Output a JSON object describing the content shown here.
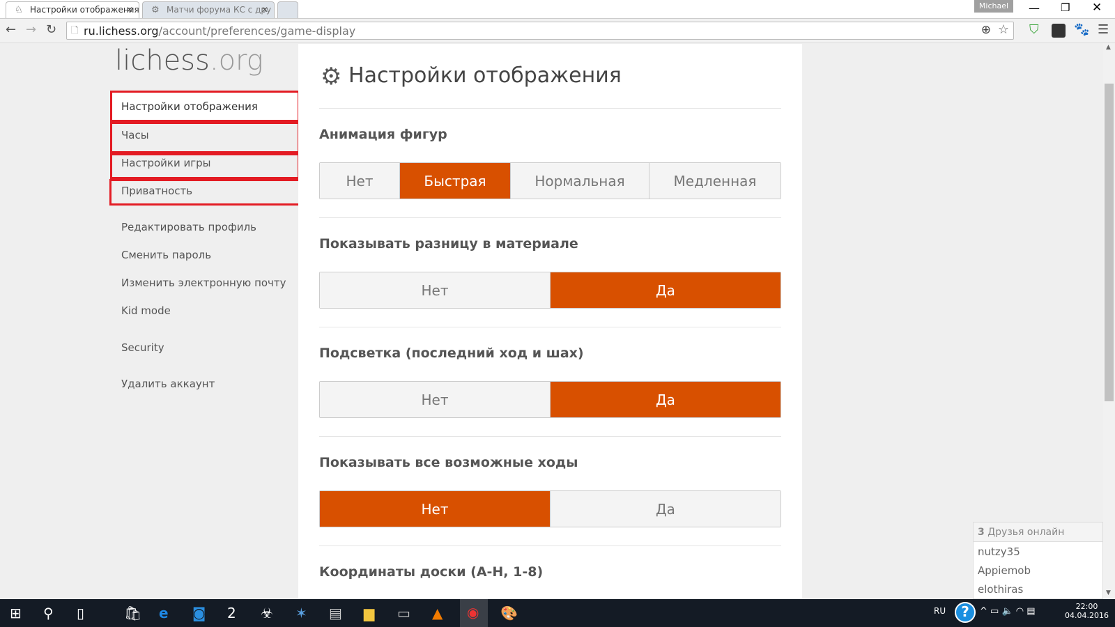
{
  "browser": {
    "tabs": [
      {
        "label": "Настройки отображения",
        "active": true
      },
      {
        "label": "Матчи форума КС с дру",
        "active": false
      }
    ],
    "user": "Michael",
    "url_host": "ru.lichess.org",
    "url_path": "/account/preferences/game-display"
  },
  "logo": {
    "main": "lichess",
    "tld": ".org"
  },
  "sidebar": {
    "items": [
      {
        "label": "Настройки отображения",
        "highlighted": true
      },
      {
        "label": "Часы",
        "highlighted": true
      },
      {
        "label": "Настройки игры",
        "highlighted": true
      },
      {
        "label": "Приватность",
        "highlighted": true
      },
      {
        "label": "Редактировать профиль"
      },
      {
        "label": "Сменить пароль"
      },
      {
        "label": "Изменить электронную почту"
      },
      {
        "label": "Kid mode"
      },
      {
        "label": "Security"
      },
      {
        "label": "Удалить аккаунт"
      }
    ]
  },
  "main": {
    "title": "Настройки отображения",
    "sections": [
      {
        "heading": "Анимация фигур",
        "options": [
          "Нет",
          "Быстрая",
          "Нормальная",
          "Медленная"
        ],
        "selected": 1
      },
      {
        "heading": "Показывать разницу в материале",
        "options": [
          "Нет",
          "Да"
        ],
        "selected": 1
      },
      {
        "heading": "Подсветка (последний ход и шах)",
        "options": [
          "Нет",
          "Да"
        ],
        "selected": 1
      },
      {
        "heading": "Показывать все возможные ходы",
        "options": [
          "Нет",
          "Да"
        ],
        "selected": 0
      },
      {
        "heading": "Координаты доски (A-H, 1-8)"
      }
    ]
  },
  "friends": {
    "count": "3",
    "label": "Друзья онлайн",
    "list": [
      "nutzy35",
      "Appiemob",
      "elothiras"
    ]
  },
  "taskbar": {
    "lang": "RU",
    "time": "22:00",
    "date": "04.04.2016"
  },
  "colors": {
    "accent": "#d85000",
    "highlight_box": "#e31b23"
  }
}
